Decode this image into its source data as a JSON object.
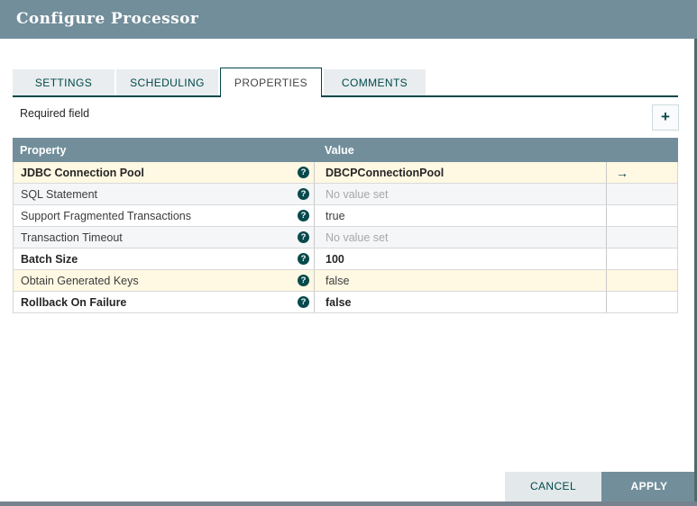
{
  "dialog": {
    "title": "Configure Processor"
  },
  "tabs": [
    {
      "label": "SETTINGS",
      "active": false
    },
    {
      "label": "SCHEDULING",
      "active": false
    },
    {
      "label": "PROPERTIES",
      "active": true
    },
    {
      "label": "COMMENTS",
      "active": false
    }
  ],
  "properties_panel": {
    "required_label": "Required field",
    "add_button": "+"
  },
  "table": {
    "headers": [
      "Property",
      "Value"
    ],
    "help_icon": "?",
    "goto_icon": "→",
    "rows": [
      {
        "name": "JDBC Connection Pool",
        "value": "DBCPConnectionPool",
        "bold": true,
        "bg": "yellow",
        "unset": false,
        "goto": true
      },
      {
        "name": "SQL Statement",
        "value": "No value set",
        "bold": false,
        "bg": "gray",
        "unset": true,
        "goto": false
      },
      {
        "name": "Support Fragmented Transactions",
        "value": "true",
        "bold": false,
        "bg": "white",
        "unset": false,
        "goto": false
      },
      {
        "name": "Transaction Timeout",
        "value": "No value set",
        "bold": false,
        "bg": "gray",
        "unset": true,
        "goto": false
      },
      {
        "name": "Batch Size",
        "value": "100",
        "bold": true,
        "bg": "white",
        "unset": false,
        "goto": false
      },
      {
        "name": "Obtain Generated Keys",
        "value": "false",
        "bold": false,
        "bg": "yellow",
        "unset": false,
        "goto": false
      },
      {
        "name": "Rollback On Failure",
        "value": "false",
        "bold": true,
        "bg": "white",
        "unset": false,
        "goto": false
      }
    ]
  },
  "footer": {
    "cancel_label": "CANCEL",
    "apply_label": "APPLY"
  },
  "colors": {
    "header_bg": "#728E9B",
    "accent": "#004849",
    "row_highlight": "#FFF8E3",
    "row_stripe": "#F4F6F7",
    "button_secondary_bg": "#E3E8EB"
  }
}
